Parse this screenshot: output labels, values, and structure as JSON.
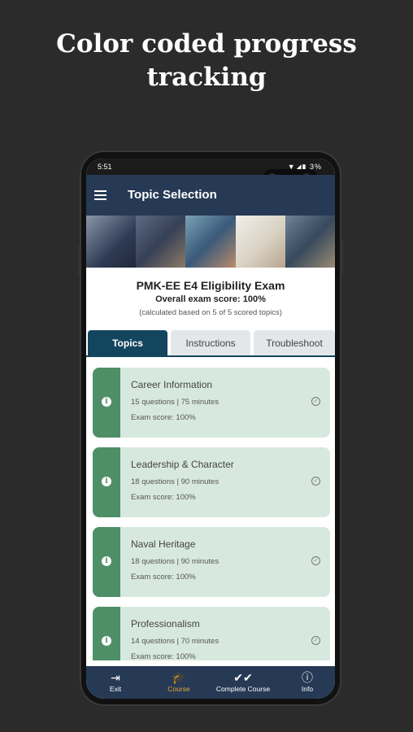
{
  "headline": {
    "line1": "Color coded progress",
    "line2": "tracking"
  },
  "status_bar": {
    "time": "5:51",
    "icons": "▼◢▮ 3%"
  },
  "app_bar": {
    "title": "Topic Selection",
    "menu_icon": "hamburger-icon"
  },
  "exam": {
    "title": "PMK-EE E4 Eligibility Exam",
    "overall_score": "Overall exam score: 100%",
    "note": "(calculated based on 5 of 5 scored topics)"
  },
  "tabs": [
    {
      "label": "Topics",
      "active": true
    },
    {
      "label": "Instructions",
      "active": false
    },
    {
      "label": "Troubleshoot",
      "active": false
    }
  ],
  "topics": [
    {
      "name": "Career Information",
      "meta": "15 questions | 75 minutes",
      "score": "Exam score: 100%"
    },
    {
      "name": "Leadership & Character",
      "meta": "18 questions | 90 minutes",
      "score": "Exam score: 100%"
    },
    {
      "name": "Naval Heritage",
      "meta": "18 questions | 90 minutes",
      "score": "Exam score: 100%"
    },
    {
      "name": "Professionalism",
      "meta": "14 questions | 70 minutes",
      "score": "Exam score: 100%"
    }
  ],
  "bottom_nav": [
    {
      "label": "Exit",
      "icon": "exit-icon",
      "active": false
    },
    {
      "label": "Course",
      "icon": "graduation-cap-icon",
      "active": true
    },
    {
      "label": "Complete Course",
      "icon": "double-check-icon",
      "active": false
    },
    {
      "label": "Info",
      "icon": "info-icon",
      "active": false
    }
  ],
  "colors": {
    "background": "#2b2b2b",
    "app_bar": "#263a55",
    "active_tab": "#13455e",
    "card_background": "#d7e9df",
    "card_strip": "#4f8f67",
    "active_nav": "#e8a43a"
  }
}
